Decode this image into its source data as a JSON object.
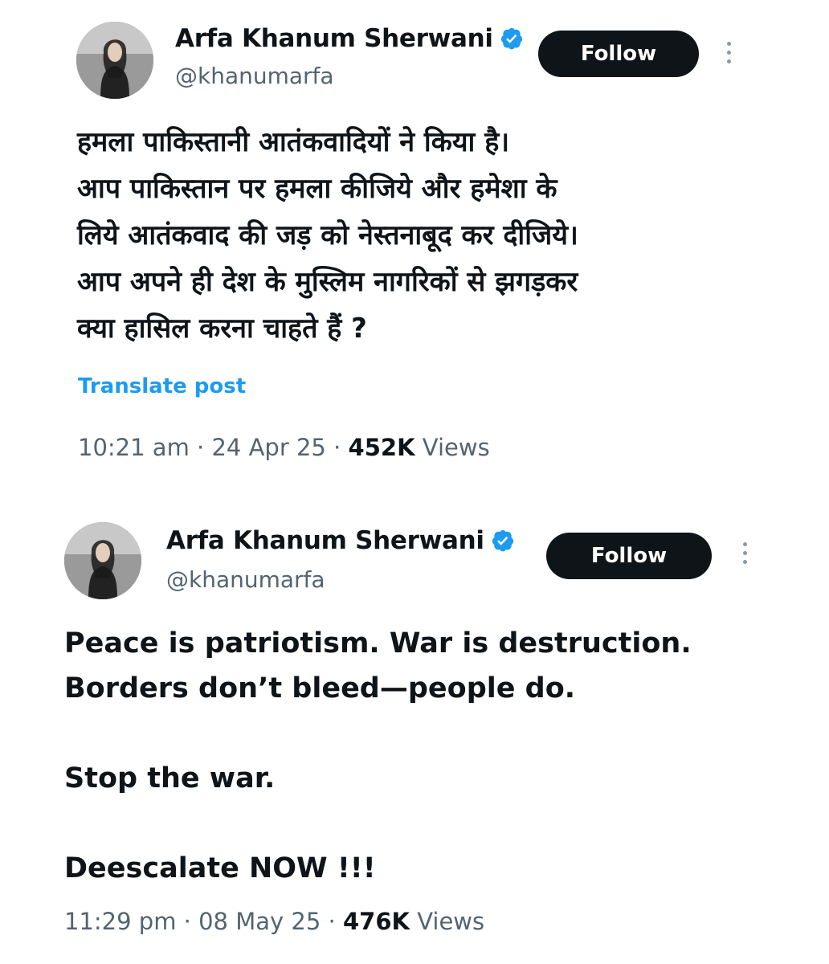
{
  "tweets": [
    {
      "author": {
        "name": "Arfa Khanum Sherwani",
        "handle": "@khanumarfa",
        "verified": true
      },
      "follow_label": "Follow",
      "body": "हमला पाकिस्तानी आतंकवादियों ने किया है।\nआप पाकिस्तान पर हमला कीजिये और हमेशा के\nलिये आतंकवाद की जड़ को नेस्तनाबूद कर दीजिये।\nआप अपने ही देश के मुस्लिम नागरिकों से झगड़कर\nक्या हासिल करना चाहते हैं ?",
      "translate_label": "Translate post",
      "time": "10:21 am",
      "date": "24 Apr 25",
      "views": "452K",
      "views_label": "Views"
    },
    {
      "author": {
        "name": "Arfa Khanum Sherwani",
        "handle": "@khanumarfa",
        "verified": true
      },
      "follow_label": "Follow",
      "body": "Peace is patriotism. War is destruction.\nBorders don’t bleed—people do.\n\nStop the war.\n\nDeescalate NOW !!!",
      "time": "11:29 pm",
      "date": "08 May 25",
      "views": "476K",
      "views_label": "Views"
    }
  ],
  "colors": {
    "verified_badge": "#1d9bf0",
    "link": "#1d9bf0",
    "secondary_text": "#536471",
    "button_bg": "#0f1419"
  },
  "icons": [
    "avatar-photo",
    "verified-badge-icon",
    "more-vertical-icon"
  ]
}
